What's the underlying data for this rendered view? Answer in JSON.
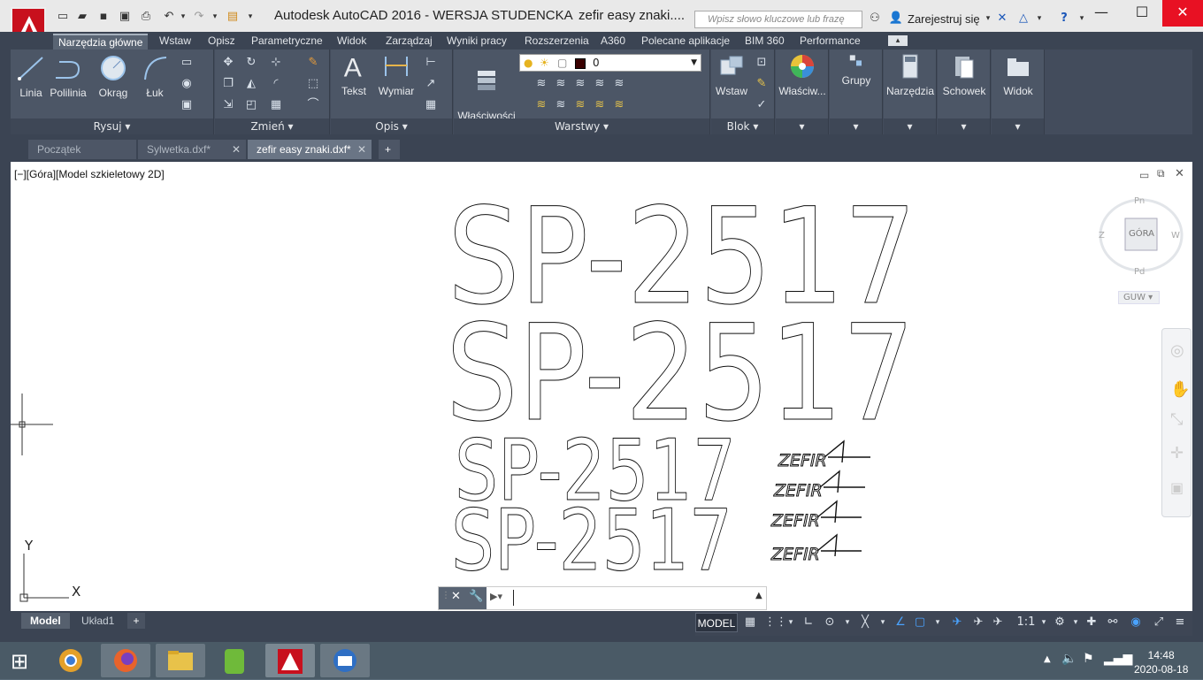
{
  "window": {
    "title": "Autodesk AutoCAD 2016 - WERSJA STUDENCKA",
    "document": "zefir easy znaki....",
    "search_placeholder": "Wpisz słowo kluczowe lub frazę",
    "sign_in": "Zarejestruj się"
  },
  "ribbon_tabs": [
    "Narzędzia główne",
    "Wstaw",
    "Opisz",
    "Parametryczne",
    "Widok",
    "Zarządzaj",
    "Wyniki pracy",
    "Rozszerzenia",
    "A360",
    "Polecane aplikacje",
    "BIM 360",
    "Performance"
  ],
  "panels": {
    "rysuj": {
      "title": "Rysuj",
      "tools": [
        "Linia",
        "Polilinia",
        "Okrąg",
        "Łuk"
      ]
    },
    "zmien": {
      "title": "Zmień"
    },
    "opis": {
      "title": "Opis",
      "tools": [
        "Tekst",
        "Wymiar"
      ]
    },
    "warstwy": {
      "title": "Warstwy",
      "props_label": "Właściwości\nwarstwy",
      "layer_value": "0"
    },
    "blok": {
      "title": "Blok",
      "tools": [
        "Wstaw"
      ]
    },
    "others": [
      "Właściw...",
      "Grupy",
      "Narzędzia",
      "Schowek",
      "Widok"
    ]
  },
  "file_tabs": [
    {
      "label": "Początek",
      "active": false
    },
    {
      "label": "Sylwetka.dxf*",
      "active": false
    },
    {
      "label": "zefir easy znaki.dxf*",
      "active": true
    }
  ],
  "viewport": {
    "label": "[−][Góra][Model szkieletowy 2D]",
    "viewcube": {
      "face": "GÓRA",
      "north": "Pn",
      "south": "Pd",
      "east": "W",
      "west": "Z",
      "wcs": "GUW"
    },
    "ucs": {
      "x": "X",
      "y": "Y"
    }
  },
  "drawing": {
    "registration": "SP-2517",
    "logo": "ZEFIR"
  },
  "layout_tabs": [
    {
      "label": "Model",
      "active": true
    },
    {
      "label": "Układ1",
      "active": false
    }
  ],
  "status": {
    "model": "MODEL",
    "scale": "1:1"
  },
  "taskbar": {
    "time": "14:48",
    "date": "2020-08-18"
  },
  "colors": {
    "accent": "#c8101d",
    "ribbon": "#434c5c",
    "canvas": "#ffffff"
  }
}
